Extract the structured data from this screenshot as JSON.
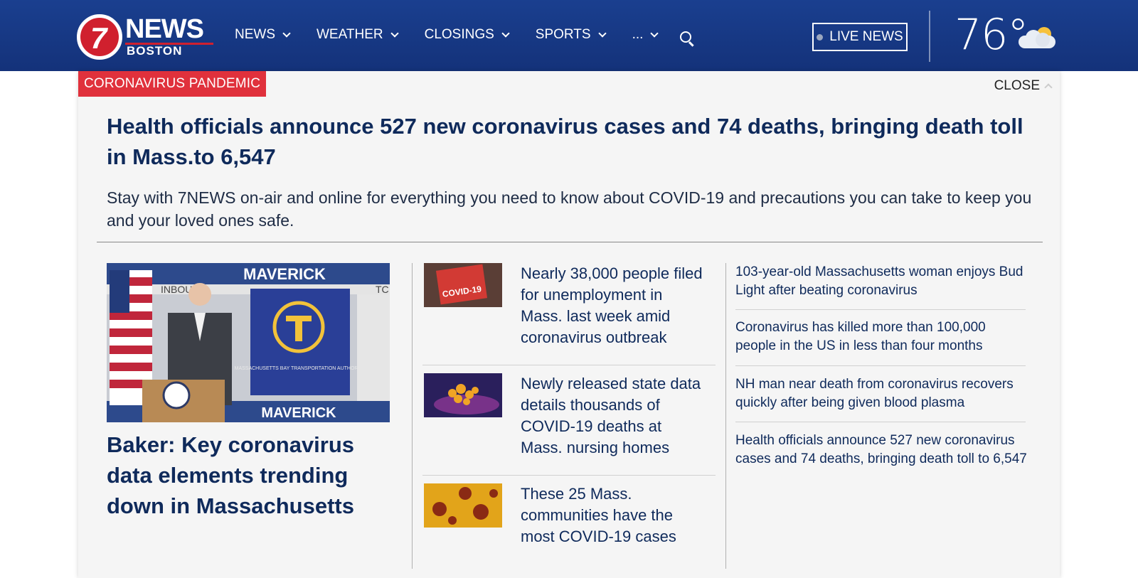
{
  "header": {
    "logo_number": "7",
    "logo_news": "NEWS",
    "logo_city": "BOSTON",
    "nav": [
      {
        "label": "NEWS"
      },
      {
        "label": "WEATHER"
      },
      {
        "label": "CLOSINGS"
      },
      {
        "label": "SPORTS"
      },
      {
        "label": "..."
      }
    ],
    "live_label": "LIVE NEWS",
    "temperature": "76°",
    "weather_icon": "partly-cloudy-icon"
  },
  "panel": {
    "tag": "CORONAVIRUS PANDEMIC",
    "close_label": "CLOSE",
    "headline": "Health officials announce 527 new coronavirus cases and 74 deaths, bringing death toll in Mass.to 6,547",
    "subhead": "Stay with 7NEWS on-air and online for everything you need to know about COVID-19 and precautions you can take to keep you and your loved ones safe.",
    "feature": {
      "image_sign_top": "MAVERICK",
      "image_sign_bottom": "MAVERICK",
      "image_banner": "MASSACHUSETTS BAY TRANSPORTATION AUTHORITY",
      "image_wall_left": "INBOU",
      "image_wall_right": "TC",
      "title": "Baker: Key coronavirus data elements trending down in Massachusetts"
    },
    "stories": [
      {
        "title": "Nearly 38,000 people filed for unemployment in Mass. last week amid coronavirus outbreak",
        "thumb_text": "COVID-19"
      },
      {
        "title": "Newly released state data details thousands of COVID-19 deaths at Mass. nursing homes"
      },
      {
        "title": "These 25 Mass. communities have the most COVID-19 cases"
      }
    ],
    "links": [
      {
        "title": "103-year-old Massachusetts woman enjoys Bud Light after beating coronavirus"
      },
      {
        "title": "Coronavirus has killed more than 100,000 people in the US in less than four months"
      },
      {
        "title": "NH man near death from coronavirus recovers quickly after being given blood plasma"
      },
      {
        "title": "Health officials announce 527 new coronavirus cases and 74 deaths, bringing death toll to 6,547"
      }
    ]
  },
  "colors": {
    "header_blue": "#14327a",
    "accent_red": "#e0313c",
    "headline_navy": "#0f2a5b"
  }
}
